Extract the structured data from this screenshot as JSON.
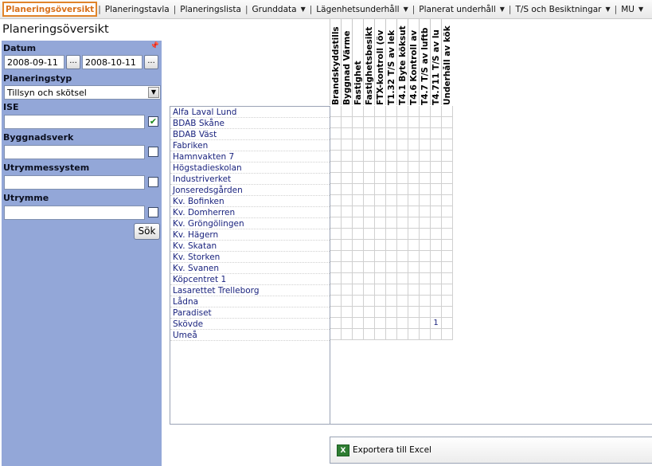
{
  "menu": [
    {
      "label": "Planeringsöversikt",
      "active": true,
      "dropdown": false
    },
    {
      "label": "Planeringstavla",
      "active": false,
      "dropdown": false
    },
    {
      "label": "Planeringslista",
      "active": false,
      "dropdown": false
    },
    {
      "label": "Grunddata",
      "active": false,
      "dropdown": true
    },
    {
      "label": "Lägenhetsunderhåll",
      "active": false,
      "dropdown": true
    },
    {
      "label": "Planerat underhåll",
      "active": false,
      "dropdown": true
    },
    {
      "label": "T/S och Besiktningar",
      "active": false,
      "dropdown": true
    },
    {
      "label": "MU",
      "active": false,
      "dropdown": true
    }
  ],
  "page_title": "Planeringsöversikt",
  "filters": {
    "datum_label": "Datum",
    "date_from": "2008-09-11",
    "date_to": "2008-10-11",
    "picker_label": "...",
    "planeringstyp_label": "Planeringstyp",
    "planeringstyp_value": "Tillsyn och skötsel",
    "ise_label": "ISE",
    "ise_value": "",
    "ise_checked": true,
    "byggnadsverk_label": "Byggnadsverk",
    "byggnadsverk_value": "",
    "byggnadsverk_checked": false,
    "utrymmessystem_label": "Utrymmessystem",
    "utrymmessystem_value": "",
    "utrymmessystem_checked": false,
    "utrymme_label": "Utrymme",
    "utrymme_value": "",
    "utrymme_checked": false,
    "search_label": "Sök"
  },
  "columns": [
    "Brandskyddstills",
    "Byggnad Värme",
    "Fastighet",
    "Fastighetsbesikt",
    "FTX-kontroll (öv",
    "T1.32 T/S av lek",
    "T4.1 Byte köksut",
    "T4.6 Kontroll av",
    "T4.7 T/S av luftb",
    "T4.711 T/S av lu",
    "Underhåll av kök"
  ],
  "rows": [
    {
      "name": "Alfa Laval Lund",
      "values": [
        "",
        "",
        "",
        "",
        "",
        "",
        "",
        "",
        "",
        "",
        ""
      ]
    },
    {
      "name": "BDAB Skåne",
      "values": [
        "",
        "",
        "",
        "",
        "",
        "",
        "",
        "",
        "",
        "",
        ""
      ]
    },
    {
      "name": "BDAB Väst",
      "values": [
        "",
        "",
        "",
        "",
        "",
        "",
        "",
        "",
        "",
        "",
        ""
      ]
    },
    {
      "name": "Fabriken",
      "values": [
        "",
        "",
        "",
        "",
        "",
        "",
        "",
        "",
        "",
        "",
        ""
      ]
    },
    {
      "name": "Hamnvakten 7",
      "values": [
        "",
        "",
        "",
        "",
        "",
        "",
        "",
        "",
        "",
        "",
        ""
      ]
    },
    {
      "name": "Högstadieskolan",
      "values": [
        "",
        "",
        "",
        "",
        "",
        "",
        "",
        "",
        "",
        "",
        ""
      ]
    },
    {
      "name": "Industriverket",
      "values": [
        "",
        "",
        "",
        "",
        "",
        "",
        "",
        "",
        "",
        "",
        ""
      ]
    },
    {
      "name": "Jonseredsgården",
      "values": [
        "",
        "",
        "",
        "",
        "",
        "",
        "",
        "",
        "",
        "",
        ""
      ]
    },
    {
      "name": "Kv. Bofinken",
      "values": [
        "",
        "",
        "",
        "",
        "",
        "",
        "",
        "",
        "",
        "",
        ""
      ]
    },
    {
      "name": "Kv. Domherren",
      "values": [
        "",
        "",
        "",
        "",
        "",
        "",
        "",
        "",
        "",
        "",
        ""
      ]
    },
    {
      "name": "Kv. Gröngölingen",
      "values": [
        "",
        "",
        "",
        "",
        "",
        "",
        "",
        "",
        "",
        "",
        ""
      ]
    },
    {
      "name": "Kv. Hägern",
      "values": [
        "",
        "",
        "",
        "",
        "",
        "",
        "",
        "",
        "",
        "",
        ""
      ]
    },
    {
      "name": "Kv. Skatan",
      "values": [
        "",
        "",
        "",
        "",
        "",
        "",
        "",
        "",
        "",
        "",
        ""
      ]
    },
    {
      "name": "Kv. Storken",
      "values": [
        "",
        "",
        "",
        "",
        "",
        "",
        "",
        "",
        "",
        "",
        ""
      ]
    },
    {
      "name": "Kv. Svanen",
      "values": [
        "",
        "",
        "",
        "",
        "",
        "",
        "",
        "",
        "",
        "",
        ""
      ]
    },
    {
      "name": "Köpcentret 1",
      "values": [
        "",
        "",
        "",
        "",
        "",
        "",
        "",
        "",
        "",
        "",
        ""
      ]
    },
    {
      "name": "Lasarettet Trelleborg",
      "values": [
        "",
        "",
        "",
        "",
        "",
        "",
        "",
        "",
        "",
        "",
        ""
      ]
    },
    {
      "name": "Lådna",
      "values": [
        "",
        "",
        "",
        "",
        "",
        "",
        "",
        "",
        "",
        "",
        ""
      ]
    },
    {
      "name": "Paradiset",
      "values": [
        "",
        "",
        "",
        "",
        "",
        "",
        "",
        "",
        "",
        "",
        ""
      ]
    },
    {
      "name": "Skövde",
      "values": [
        "",
        "",
        "",
        "",
        "",
        "",
        "",
        "",
        "",
        "1",
        ""
      ]
    },
    {
      "name": "Umeå",
      "values": [
        "",
        "",
        "",
        "",
        "",
        "",
        "",
        "",
        "",
        "",
        ""
      ]
    }
  ],
  "export": {
    "label": "Exportera till Excel",
    "icon": "excel-icon"
  },
  "colors": {
    "accent": "#e0842a",
    "panel": "#93a7d8",
    "link": "#1a237e"
  }
}
